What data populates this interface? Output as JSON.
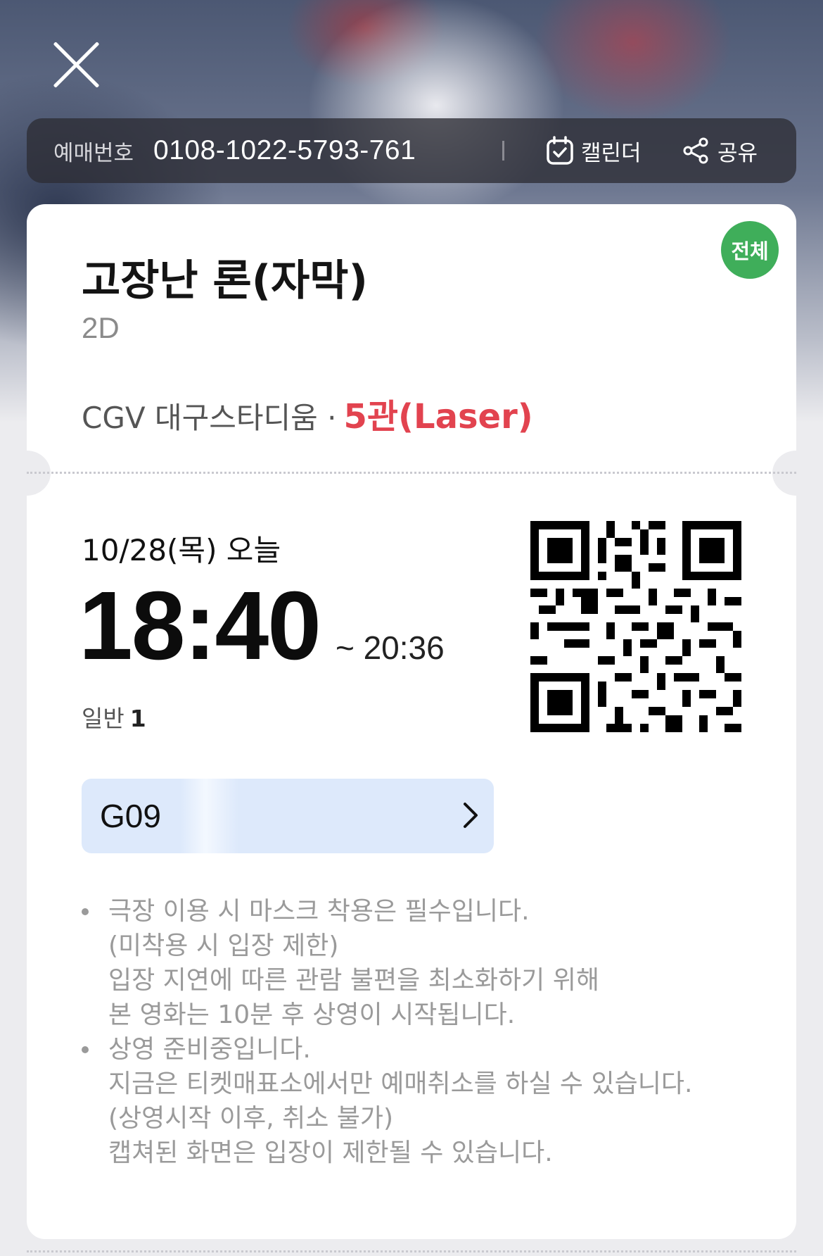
{
  "header": {
    "booking_label": "예매번호",
    "booking_number": "0108-1022-5793-761",
    "calendar_label": "캘린더",
    "share_label": "공유"
  },
  "movie": {
    "rating": "전체",
    "title": "고장난 론(자막)",
    "format": "2D",
    "theater": "CGV 대구스타디움 ·",
    "screen": "5관(Laser)"
  },
  "showtime": {
    "date": "10/28(목) 오늘",
    "start": "18:40",
    "end": "~ 20:36",
    "ticket_type": "일반",
    "ticket_count": "1"
  },
  "seat": {
    "label": "G09"
  },
  "notices": {
    "notice1_lines": [
      "극장 이용 시 마스크 착용은 필수입니다.",
      "(미착용 시 입장 제한)",
      "입장 지연에 따른 관람 불편을 최소화하기 위해",
      "본 영화는 10분 후 상영이 시작됩니다."
    ],
    "notice2_lines": [
      "상영 준비중입니다.",
      "지금은 티켓매표소에서만 예매취소를 하실 수 있습니다.",
      "(상영시작 이후, 취소 불가)",
      "캡쳐된 화면은 입장이 제한될 수 있습니다."
    ]
  },
  "colors": {
    "accent_red": "#e2434f",
    "rating_green": "#3fae5a",
    "seat_bg": "#dde9fb"
  }
}
